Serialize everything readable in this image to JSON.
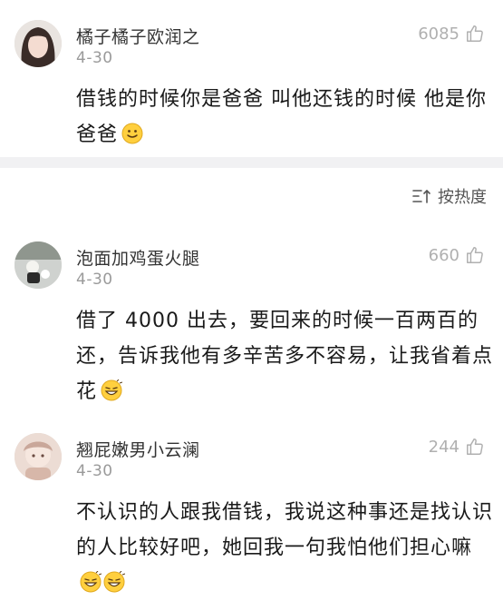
{
  "comments": [
    {
      "username": "橘子橘子欧润之",
      "date": "4-30",
      "likes": "6085",
      "text": "借钱的时候你是爸爸 叫他还钱的时候 他是你爸爸"
    },
    {
      "username": "泡面加鸡蛋火腿",
      "date": "4-30",
      "likes": "660",
      "text": "借了 4000 出去，要回来的时候一百两百的还，告诉我他有多辛苦多不容易，让我省着点花"
    },
    {
      "username": "翘屁嫩男小云澜",
      "date": "4-30",
      "likes": "244",
      "text": "不认识的人跟我借钱，我说这种事还是找认识的人比较好吧，她回我一句我怕他们担心嘛"
    }
  ],
  "sort": {
    "label": "按热度",
    "icon": "sort-icon"
  },
  "icons": {
    "like": "thumbs-up-icon",
    "smile": "smile-emoji",
    "grin": "grin-emoji"
  },
  "colors": {
    "divider": "#f1f1f3",
    "meta": "#9a9a9a",
    "likes": "#b0b0b0",
    "emoji": "#ffcf3e"
  }
}
